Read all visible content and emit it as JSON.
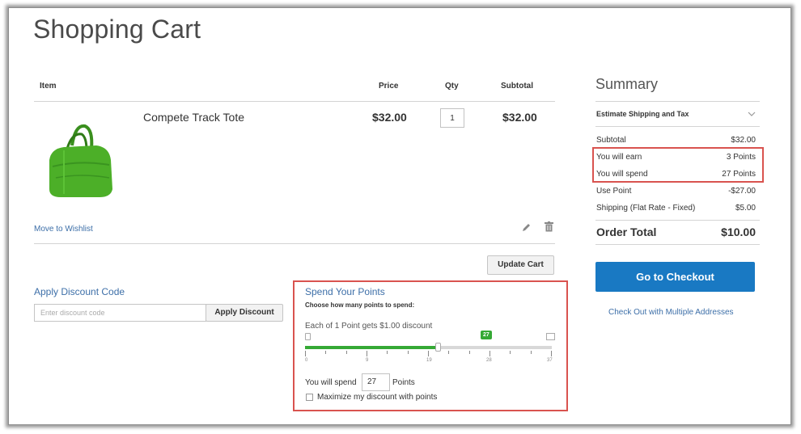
{
  "page": {
    "title": "Shopping Cart"
  },
  "cart": {
    "headers": {
      "item": "Item",
      "price": "Price",
      "qty": "Qty",
      "subtotal": "Subtotal"
    },
    "items": [
      {
        "name": "Compete Track Tote",
        "price": "$32.00",
        "qty": "1",
        "subtotal": "$32.00",
        "image_color": "#4caf28"
      }
    ],
    "move_to_wishlist": "Move to Wishlist",
    "update_cart": "Update Cart"
  },
  "discount": {
    "title": "Apply Discount Code",
    "placeholder": "Enter discount code",
    "button": "Apply Discount"
  },
  "points": {
    "title": "Spend Your Points",
    "subtitle": "Choose how many points to spend:",
    "rate": "Each of 1 Point gets $1.00 discount",
    "slider": {
      "value": 27,
      "max": 37,
      "badge": "27",
      "scale_labels": [
        "0",
        "9",
        "19",
        "28",
        "37"
      ]
    },
    "spend_prefix": "You will spend",
    "spend_value": "27",
    "spend_suffix": "Points",
    "maximize_label": "Maximize my discount with points"
  },
  "summary": {
    "title": "Summary",
    "estimate": "Estimate Shipping and Tax",
    "rows": [
      {
        "label": "Subtotal",
        "value": "$32.00"
      },
      {
        "label": "You will earn",
        "value": "3 Points"
      },
      {
        "label": "You will spend",
        "value": "27 Points"
      },
      {
        "label": "Use Point",
        "value": "-$27.00"
      },
      {
        "label": "Shipping (Flat Rate - Fixed)",
        "value": "$5.00"
      }
    ],
    "order_total_label": "Order Total",
    "order_total_value": "$10.00",
    "checkout": "Go to Checkout",
    "multi_address": "Check Out with Multiple Addresses"
  },
  "colors": {
    "accent": "#1979c3",
    "highlight": "#d9534f",
    "slider": "#35a935",
    "link": "#3d6fa8"
  }
}
